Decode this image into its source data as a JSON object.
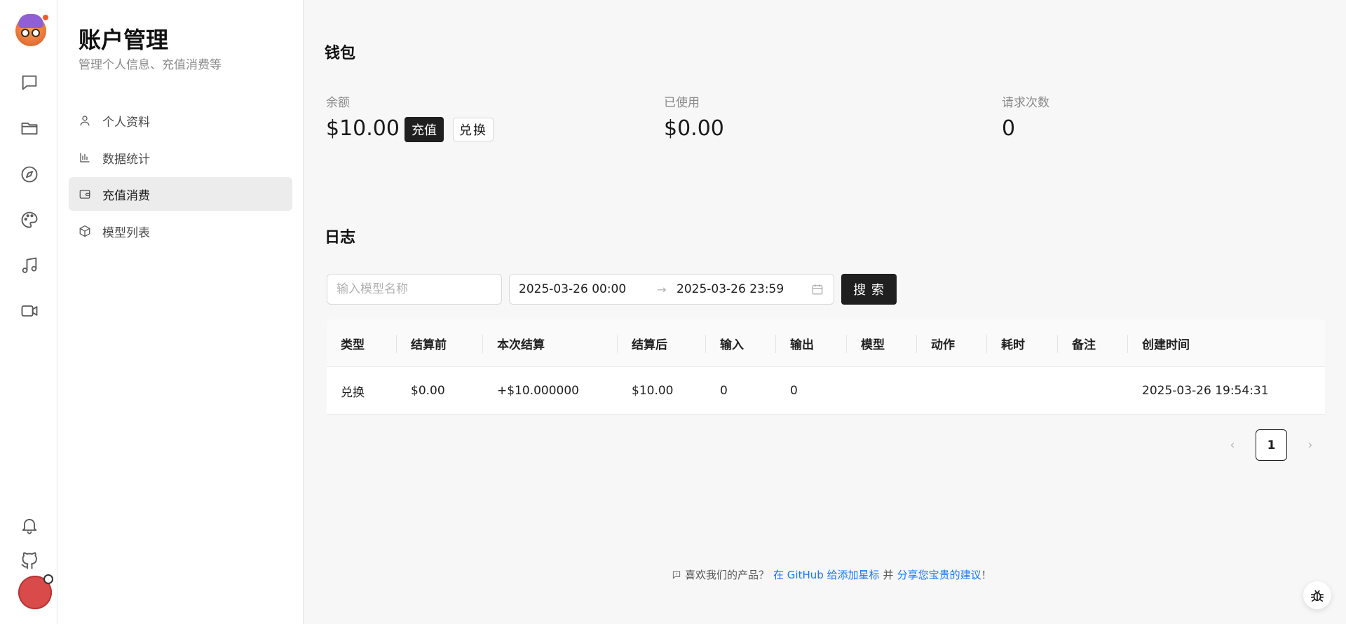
{
  "rail": {
    "icons": [
      "chat-icon",
      "folder-icon",
      "compass-icon",
      "palette-icon",
      "music-icon",
      "video-icon",
      "bell-icon",
      "github-icon"
    ]
  },
  "sidebar": {
    "title": "账户管理",
    "subtitle": "管理个人信息、充值消费等",
    "items": [
      {
        "label": "个人资料",
        "icon": "user-icon"
      },
      {
        "label": "数据统计",
        "icon": "bar-chart-icon"
      },
      {
        "label": "充值消费",
        "icon": "wallet-icon",
        "active": true
      },
      {
        "label": "模型列表",
        "icon": "cube-icon"
      }
    ]
  },
  "wallet": {
    "heading": "钱包",
    "balance_label": "余额",
    "balance_value": "$10.00",
    "recharge_label": "充值",
    "redeem_label": "兑换",
    "used_label": "已使用",
    "used_value": "$0.00",
    "requests_label": "请求次数",
    "requests_value": "0"
  },
  "log": {
    "heading": "日志",
    "model_placeholder": "输入模型名称",
    "date_start": "2025-03-26 00:00",
    "date_separator": "→",
    "date_end": "2025-03-26 23:59",
    "search_label": "搜 索",
    "columns": [
      "类型",
      "结算前",
      "本次结算",
      "结算后",
      "输入",
      "输出",
      "模型",
      "动作",
      "耗时",
      "备注",
      "创建时间"
    ],
    "rows": [
      [
        "兑换",
        "$0.00",
        "+$10.000000",
        "$10.00",
        "0",
        "0",
        "",
        "",
        "",
        "",
        "2025-03-26 19:54:31"
      ]
    ],
    "pagination": {
      "prev": "‹",
      "current": "1",
      "next": "›"
    }
  },
  "footer": {
    "text_1": "喜欢我们的产品？",
    "link_1": "在 GitHub 给添加星标",
    "text_2": "并",
    "link_2": "分享您宝贵的建议",
    "text_3": "！"
  },
  "colors": {
    "accent_dark": "#1f1f1f",
    "link": "#1677ff",
    "avatar": "#d94b4b"
  }
}
